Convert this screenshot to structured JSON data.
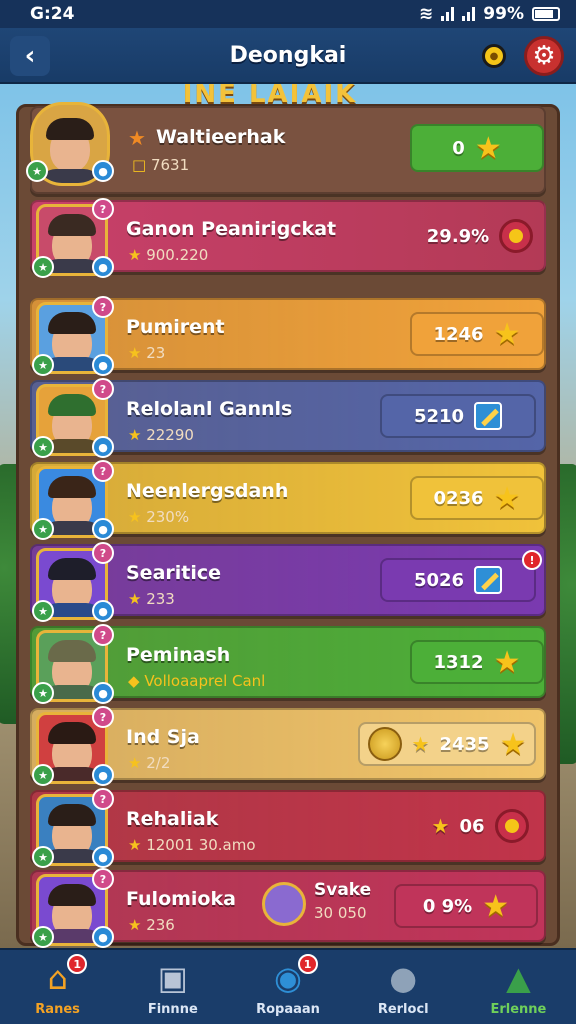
{
  "status": {
    "time": "G:24",
    "battery": "99%"
  },
  "header": {
    "title": "Deongkai",
    "back_icon": "back-arrow-icon",
    "coin_icon": "coin-icon",
    "settings_icon": "gear-icon"
  },
  "banner": {
    "text": "INE LAIAIK"
  },
  "players": [
    {
      "name": "Waltieerhak",
      "sub": "7631",
      "value": "0",
      "trailing": "star",
      "color": "#4caf38"
    },
    {
      "name": "Ganon Peanirigckat",
      "sub": "900.220",
      "value": "29.9%",
      "trailing": "coin",
      "color": "#b93a5a"
    },
    {
      "name": "Pumirent",
      "sub": "23",
      "value": "1246",
      "trailing": "star",
      "color": "#f0a23a"
    },
    {
      "name": "Relolanl Gannls",
      "sub": "22290",
      "value": "5210",
      "trailing": "pencil",
      "color": "#5465a8"
    },
    {
      "name": "Neenlergsdanh",
      "sub": "230%",
      "value": "0236",
      "trailing": "star",
      "color": "#f0c23a"
    },
    {
      "name": "Searitice",
      "sub": "233",
      "value": "5026",
      "trailing": "pencil",
      "color": "#7a3ab0"
    },
    {
      "name": "Peminash",
      "sub": "Volloaaprel Canl",
      "value": "1312",
      "trailing": "star",
      "color": "#4caf38"
    },
    {
      "name": "Ind Sja",
      "sub": "2/2",
      "value": "2435",
      "trailing": "star",
      "color": "#f1c56a"
    },
    {
      "name": "Rehaliak",
      "sub": "12001 30.amo",
      "value": "06",
      "trailing": "coin",
      "color": "#c0344a"
    },
    {
      "name": "Fulomioka",
      "sub": "236",
      "value": "0 9%",
      "trailing": "star",
      "color": "#c0345a",
      "friend_name": "Svake",
      "friend_sub": "30 050"
    }
  ],
  "nav": [
    {
      "label": "Ranes",
      "icon": "home-icon",
      "badge": "1"
    },
    {
      "label": "Finnne",
      "icon": "box-icon",
      "badge": ""
    },
    {
      "label": "Ropaaan",
      "icon": "globe-icon",
      "badge": "1"
    },
    {
      "label": "Rerlocl",
      "icon": "chat-icon",
      "badge": ""
    },
    {
      "label": "Erlenne",
      "icon": "tree-icon",
      "badge": ""
    }
  ]
}
